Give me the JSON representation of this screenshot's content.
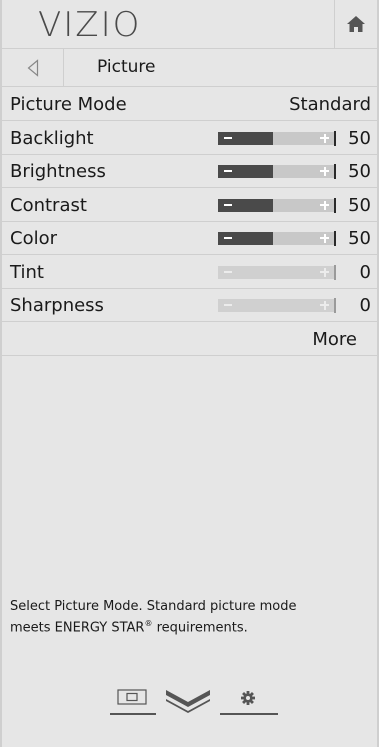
{
  "header": {
    "brand": "VIZIO",
    "home_icon": "home-icon"
  },
  "subheader": {
    "back_icon": "back-arrow-icon",
    "title": "Picture"
  },
  "rows": [
    {
      "label": "Picture Mode",
      "value": "Standard",
      "type": "option"
    },
    {
      "label": "Backlight",
      "value": "50",
      "type": "slider",
      "level": 0.5,
      "enabled": true
    },
    {
      "label": "Brightness",
      "value": "50",
      "type": "slider",
      "level": 0.5,
      "enabled": true
    },
    {
      "label": "Contrast",
      "value": "50",
      "type": "slider",
      "level": 0.5,
      "enabled": true
    },
    {
      "label": "Color",
      "value": "50",
      "type": "slider",
      "level": 0.5,
      "enabled": true
    },
    {
      "label": "Tint",
      "value": "0",
      "type": "slider",
      "level": 0.5,
      "enabled": false
    },
    {
      "label": "Sharpness",
      "value": "0",
      "type": "slider",
      "level": 0,
      "enabled": false
    },
    {
      "label": "More",
      "type": "more"
    }
  ],
  "description": {
    "line1": "Select Picture Mode. Standard picture mode",
    "line2_pre": "meets ENERGY STAR",
    "line2_sup": "®",
    "line2_post": " requirements."
  },
  "bottom_nav": [
    "input-icon",
    "vizio-v-icon",
    "settings-gear-icon"
  ],
  "colors": {
    "background": "#e6e6e6",
    "slider_fill": "#4a4a4a",
    "slider_track": "#c8c8c8",
    "divider": "#cfcfcf"
  }
}
